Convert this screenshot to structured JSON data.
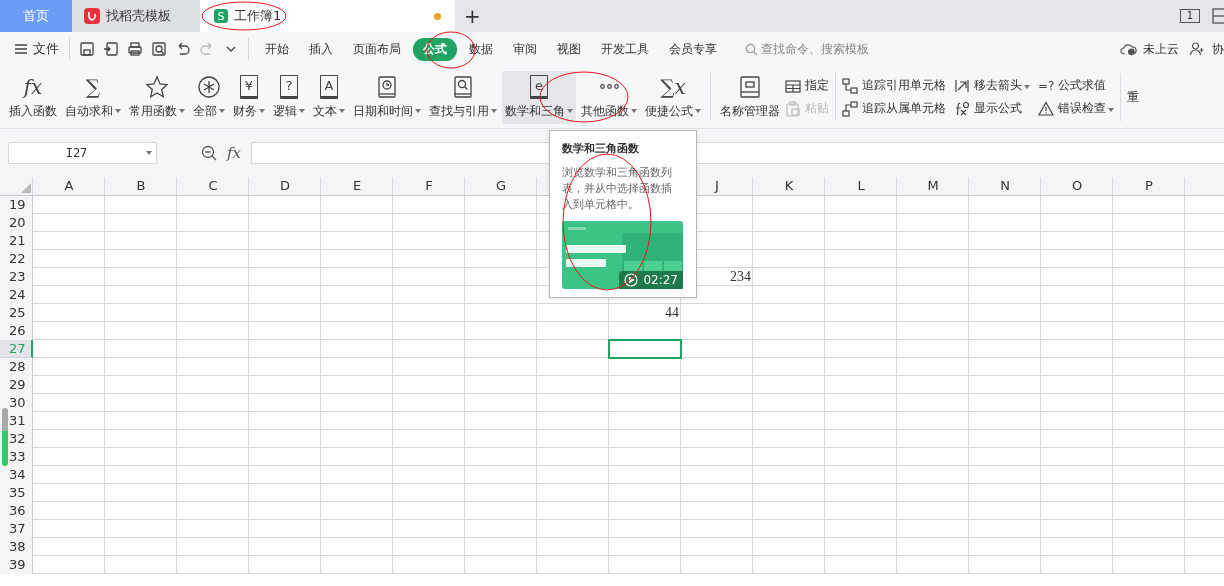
{
  "tabs": [
    {
      "label": "首页",
      "kind": "home",
      "selected": false
    },
    {
      "label": "找稻壳模板",
      "kind": "docer",
      "selected": false
    },
    {
      "label": "工作簿1",
      "kind": "sheet",
      "icon": "S",
      "selected": true,
      "modified": true
    }
  ],
  "new_tab": "+",
  "window_icon_text": "1",
  "menu": {
    "file": "文件",
    "quick_access": [
      {
        "kind": "save",
        "disabled": false
      },
      {
        "kind": "export",
        "disabled": false
      },
      {
        "kind": "print",
        "disabled": false
      },
      {
        "kind": "preview",
        "disabled": false
      },
      {
        "kind": "undo",
        "disabled": false
      },
      {
        "kind": "redo",
        "disabled": true
      },
      {
        "kind": "more",
        "disabled": false
      }
    ],
    "tabs": [
      {
        "label": "开始",
        "selected": false
      },
      {
        "label": "插入",
        "selected": false
      },
      {
        "label": "页面布局",
        "selected": false
      },
      {
        "label": "公式",
        "selected": true
      },
      {
        "label": "数据",
        "selected": false
      },
      {
        "label": "审阅",
        "selected": false
      },
      {
        "label": "视图",
        "selected": false
      },
      {
        "label": "开发工具",
        "selected": false
      },
      {
        "label": "会员专享",
        "selected": false
      }
    ],
    "search": {
      "placeholder": "查找命令、搜索模板"
    },
    "cloud": "未上云",
    "share": "协"
  },
  "ribbon": {
    "function_buttons": [
      {
        "label": "插入函数",
        "kind": "glyph",
        "icon": "fx",
        "dropdown": false,
        "selected": false
      },
      {
        "label": "自动求和",
        "kind": "glyph",
        "icon": "∑",
        "dropdown": true,
        "selected": false
      },
      {
        "label": "常用函数",
        "kind": "star",
        "dropdown": true,
        "selected": false
      },
      {
        "label": "全部",
        "kind": "asterisk",
        "dropdown": true,
        "selected": false
      },
      {
        "label": "财务",
        "kind": "book",
        "icon": "¥",
        "dropdown": true,
        "selected": false
      },
      {
        "label": "逻辑",
        "kind": "book",
        "icon": "?",
        "dropdown": true,
        "selected": false
      },
      {
        "label": "文本",
        "kind": "book",
        "icon": "A",
        "dropdown": true,
        "selected": false
      },
      {
        "label": "日期和时间",
        "kind": "book-clock",
        "dropdown": true,
        "selected": false
      },
      {
        "label": "查找与引用",
        "kind": "book-search",
        "dropdown": true,
        "selected": false
      },
      {
        "label": "数学和三角",
        "kind": "book",
        "icon": "e",
        "dropdown": true,
        "selected": true
      },
      {
        "label": "其他函数",
        "kind": "dots",
        "dropdown": true,
        "selected": false
      },
      {
        "label": "便捷公式",
        "kind": "glyph",
        "icon": "∑x",
        "dropdown": true,
        "selected": false
      }
    ],
    "name_manager": "名称管理器",
    "name_buttons": [
      {
        "label": "指定",
        "kind": "table",
        "disabled": false
      },
      {
        "label": "粘贴",
        "kind": "clipboard",
        "disabled": true
      }
    ],
    "audit_buttons": [
      {
        "label": "追踪引用单元格",
        "kind": "trace-in",
        "dropdown": false
      },
      {
        "label": "追踪从属单元格",
        "kind": "trace-out",
        "dropdown": false
      },
      {
        "label": "移去箭头",
        "kind": "arrows",
        "dropdown": true
      },
      {
        "label": "显示公式",
        "kind": "show-formula",
        "dropdown": false
      },
      {
        "label": "公式求值",
        "kind": "glyph",
        "icon": "=?",
        "dropdown": false
      },
      {
        "label": "错误检查",
        "kind": "warning",
        "dropdown": true
      }
    ],
    "cut_label": "重"
  },
  "formula_bar": {
    "name_box": "I27",
    "fx": "fx"
  },
  "grid": {
    "columns": [
      "A",
      "B",
      "C",
      "D",
      "E",
      "F",
      "G",
      null,
      null,
      "J",
      "K",
      "L",
      "M",
      "N",
      "O",
      "P",
      null
    ],
    "rows": [
      {
        "number": "19",
        "selected": false
      },
      {
        "number": "20",
        "selected": false
      },
      {
        "number": "21",
        "selected": false
      },
      {
        "number": "22",
        "selected": false
      },
      {
        "number": "23",
        "selected": false,
        "cells": [
          null,
          null,
          null,
          null,
          null,
          null,
          null,
          null,
          null,
          {
            "text": "234",
            "selected": false
          }
        ]
      },
      {
        "number": "24",
        "selected": false
      },
      {
        "number": "25",
        "selected": false,
        "cells": [
          null,
          null,
          null,
          null,
          null,
          null,
          null,
          null,
          {
            "text": "44",
            "selected": false
          }
        ]
      },
      {
        "number": "26",
        "selected": false
      },
      {
        "number": "27",
        "selected": true,
        "cells": [
          null,
          null,
          null,
          null,
          null,
          null,
          null,
          null,
          {
            "selected": true
          }
        ]
      },
      {
        "number": "28",
        "selected": false
      },
      {
        "number": "29",
        "selected": false
      },
      {
        "number": "30",
        "selected": false
      },
      {
        "number": "31",
        "selected": false
      },
      {
        "number": "32",
        "selected": false
      },
      {
        "number": "33",
        "selected": false
      },
      {
        "number": "34",
        "selected": false
      },
      {
        "number": "35",
        "selected": false
      },
      {
        "number": "36",
        "selected": false
      },
      {
        "number": "37",
        "selected": false
      },
      {
        "number": "38",
        "selected": false
      },
      {
        "number": "39",
        "selected": false
      }
    ]
  },
  "tooltip": {
    "title": "数学和三角函数",
    "description": "浏览数学和三角函数列表，并从中选择函数插入到单元格中。",
    "video": {
      "kind": "picture",
      "duration": "02:27"
    }
  },
  "annotations": [
    {
      "kind": "ellipse"
    },
    {
      "kind": "ellipse"
    },
    {
      "kind": "ellipse"
    },
    {
      "kind": "ellipse"
    }
  ]
}
